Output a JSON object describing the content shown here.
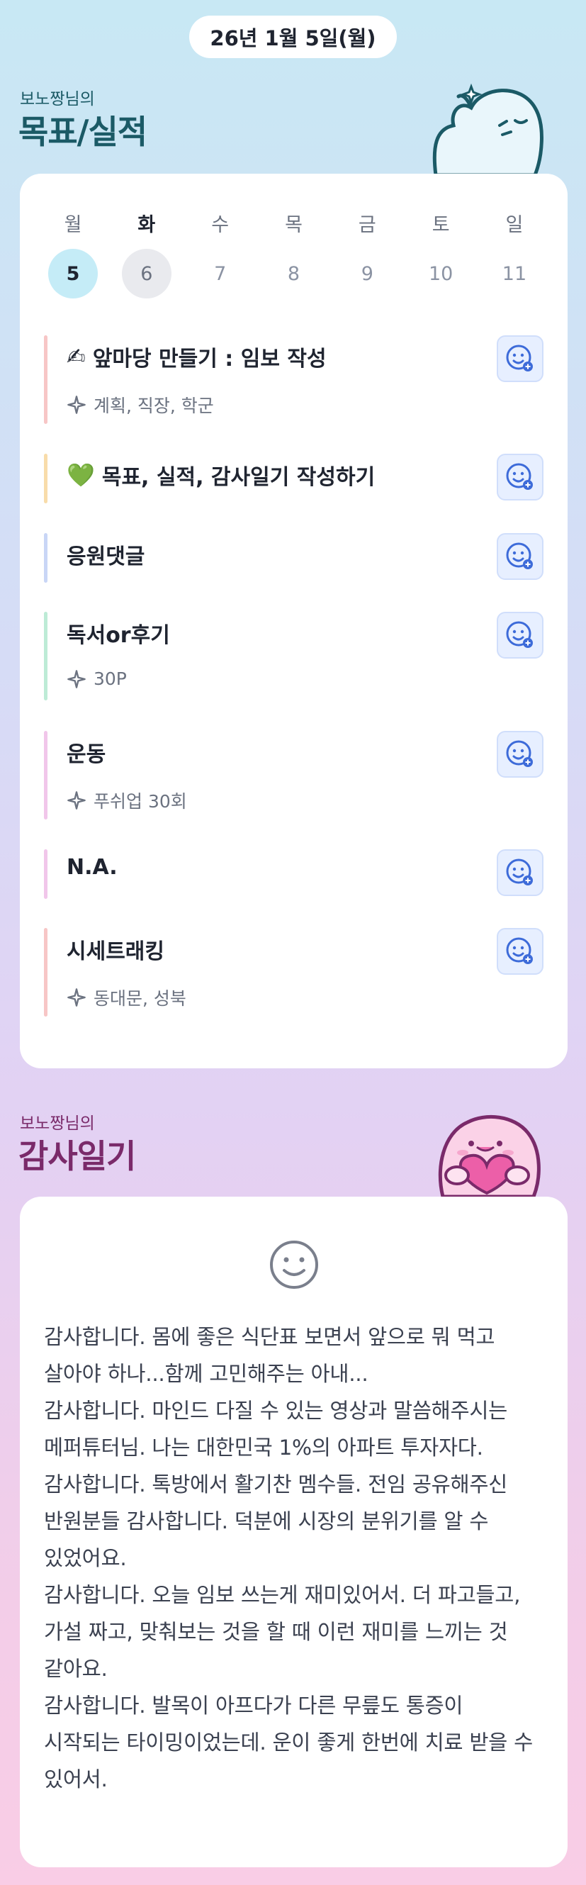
{
  "header": {
    "date": "26년 1월 5일(월)"
  },
  "goals_section": {
    "subtitle": "보노짱님의",
    "title": "목표/실적"
  },
  "week": {
    "days": [
      {
        "name": "월",
        "num": "5",
        "state": "today"
      },
      {
        "name": "화",
        "num": "6",
        "state": "selected"
      },
      {
        "name": "수",
        "num": "7",
        "state": ""
      },
      {
        "name": "목",
        "num": "8",
        "state": ""
      },
      {
        "name": "금",
        "num": "9",
        "state": ""
      },
      {
        "name": "토",
        "num": "10",
        "state": ""
      },
      {
        "name": "일",
        "num": "11",
        "state": ""
      }
    ]
  },
  "tasks": [
    {
      "emoji": "✍",
      "title": "앞마당 만들기 : 임보 작성",
      "sub": "계획, 직장, 학군",
      "color": "#f7c6c6"
    },
    {
      "emoji": "💚",
      "title": "목표, 실적, 감사일기 작성하기",
      "sub": "",
      "color": "#f8dcaa"
    },
    {
      "emoji": "",
      "title": "응원댓글",
      "sub": "",
      "color": "#c9d6f6"
    },
    {
      "emoji": "",
      "title": "독서or후기",
      "sub": "30P",
      "color": "#bdebd6"
    },
    {
      "emoji": "",
      "title": "운동",
      "sub": "푸쉬업 30회",
      "color": "#f1c6ea"
    },
    {
      "emoji": "",
      "title": "N.A.",
      "sub": "",
      "color": "#f1c6ea"
    },
    {
      "emoji": "",
      "title": "시세트래킹",
      "sub": "동대문, 성북",
      "color": "#f7c6c6"
    }
  ],
  "gratitude_section": {
    "subtitle": "보노짱님의",
    "title": "감사일기"
  },
  "diary": {
    "icon": "smile-icon",
    "text": "감사합니다. 몸에 좋은 식단표 보면서 앞으로 뭐 먹고 살아야 하나...함께 고민해주는 아내...\n감사합니다. 마인드 다질 수 있는 영상과 말씀해주시는 메퍼튜터님. 나는 대한민국 1%의 아파트 투자자다.\n감사합니다. 톡방에서 활기찬 멤수들. 전임 공유해주신 반원분들 감사합니다. 덕분에 시장의 분위기를 알 수 있었어요.\n감사합니다. 오늘 임보 쓰는게 재미있어서. 더 파고들고, 가설 짜고, 맞춰보는 것을 할 때 이런 재미를 느끼는 것 같아요.\n감사합니다. 발목이 아프다가 다른 무릎도 통증이 시작되는 타이밍이었는데. 운이 좋게 한번에 치료 받을 수 있어서."
  },
  "colors": {
    "title_teal": "#1b5a66",
    "title_purple": "#7a2a6a",
    "accent_blue": "#3d6bd9"
  }
}
